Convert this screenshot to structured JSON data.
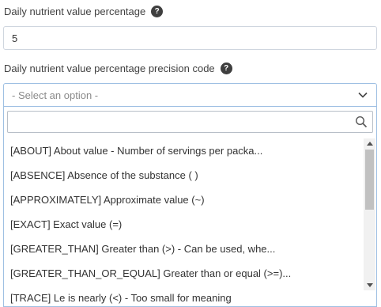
{
  "nutrient_percentage": {
    "label": "Daily nutrient value percentage",
    "help_glyph": "?",
    "value": "5"
  },
  "precision_code": {
    "label": "Daily nutrient value percentage precision code",
    "help_glyph": "?",
    "placeholder": "- Select an option -",
    "search_value": "",
    "options": [
      "[ABOUT] About value - Number of servings per packa...",
      "[ABSENCE] Absence of the substance ( )",
      "[APPROXIMATELY] Approximate value (~)",
      "[EXACT] Exact value (=)",
      "[GREATER_THAN] Greater than (>) - Can be used, whe...",
      "[GREATER_THAN_OR_EQUAL] Greater than or equal (>=)...",
      "[TRACE] Le is nearly (<) - Too small for meaning"
    ]
  },
  "colors": {
    "focus_border": "#9fc0e3",
    "input_border": "#cfd6df",
    "help_icon_bg": "#3f3f3f"
  }
}
